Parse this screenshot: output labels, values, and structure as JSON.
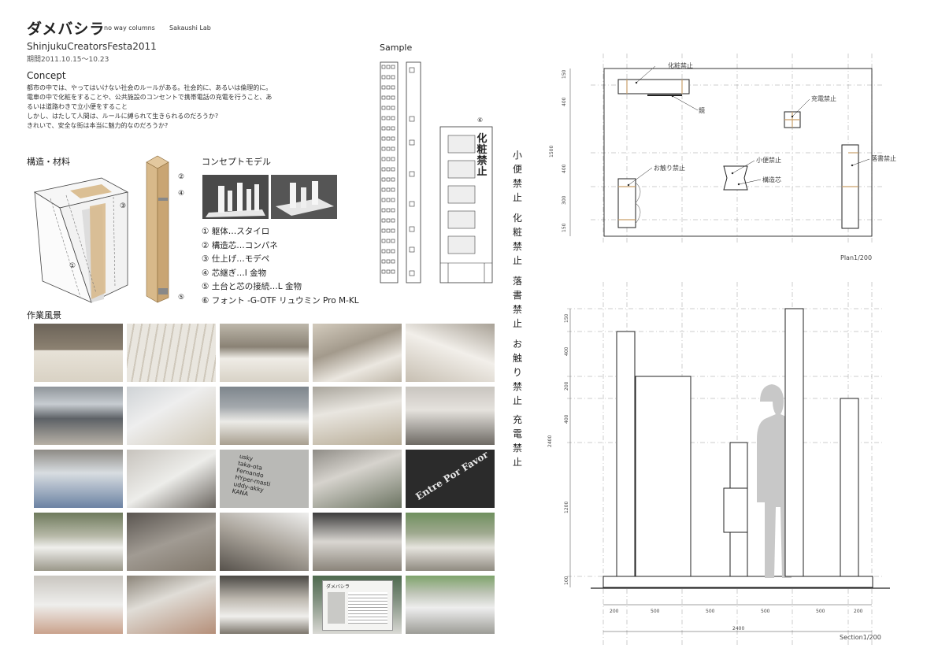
{
  "header": {
    "title": "ダメバシラ",
    "subtitle": "no way columns",
    "lab": "Sakaushi Lab",
    "event": "ShinjukuCreatorsFesta2011",
    "period": "期間2011.10.15〜10.23"
  },
  "concept": {
    "heading": "Concept",
    "lines": [
      "都市の中では、やってはいけない社会のルールがある。社会的に、あるいは倫理的に。",
      "電車の中で化粧をすることや、公共施設のコンセントで携帯電話の充電を行うこと、あ",
      "るいは道路わきで立小便をすること",
      "しかし、はたして人間は、ルールに縛られて生きられるのだろうか?",
      "きれいで、安全な街は本当に魅力的なのだろうか?"
    ]
  },
  "structure": {
    "heading": "構造・材料",
    "markers": [
      "①",
      "②",
      "③",
      "④",
      "⑤"
    ]
  },
  "model": {
    "heading": "コンセプトモデル"
  },
  "materials": [
    "① 躯体…スタイロ",
    "② 構造芯…コンパネ",
    "③ 仕上げ…モデペ",
    "④ 芯継ぎ…I 金物",
    "⑤ 土台と芯の接続…L 金物",
    "⑥ フォント -G-OTF リュウミン Pro M-KL"
  ],
  "sample": {
    "heading": "Sample",
    "marker": "⑥",
    "column_text": "化粧禁止"
  },
  "work": {
    "heading": "作業風景"
  },
  "photo_texts": {
    "names": [
      "usky",
      "taka-ota",
      "Fernando",
      "HYper-masti",
      "uddy-akky",
      "KANA"
    ],
    "sign": "Entre Por Favor",
    "panel_title": "ダメバシラ"
  },
  "rules": [
    {
      "chars": [
        "小",
        "便",
        "禁",
        "止"
      ]
    },
    {
      "chars": [
        "化",
        "粧",
        "禁",
        "止"
      ]
    },
    {
      "chars": [
        "落",
        "書",
        "禁",
        "止"
      ]
    },
    {
      "chars": [
        "お",
        "触",
        "り",
        "禁",
        "止"
      ]
    },
    {
      "chars": [
        "充",
        "電",
        "禁",
        "止"
      ]
    }
  ],
  "plan": {
    "caption": "Plan1/200",
    "labels": {
      "makeup": "化粧禁止",
      "mirror": "鏡",
      "charge": "充電禁止",
      "urine": "小便禁止",
      "core": "構造芯",
      "touch": "お触り禁止",
      "graffiti": "落書禁止"
    },
    "dims_left": [
      "150",
      "400",
      "1500",
      "400",
      "300",
      "150"
    ]
  },
  "section": {
    "caption": "Section1/200",
    "dims_left": [
      "150",
      "400",
      "200",
      "400",
      "2400",
      "1200",
      "100"
    ],
    "dims_bottom": [
      "200",
      "500",
      "500",
      "500",
      "500",
      "200"
    ],
    "total": "2400"
  },
  "colors": {
    "wood": "#d8b98a",
    "line": "#222222",
    "dash": "#888888",
    "silhouette": "#c8c8c8"
  }
}
